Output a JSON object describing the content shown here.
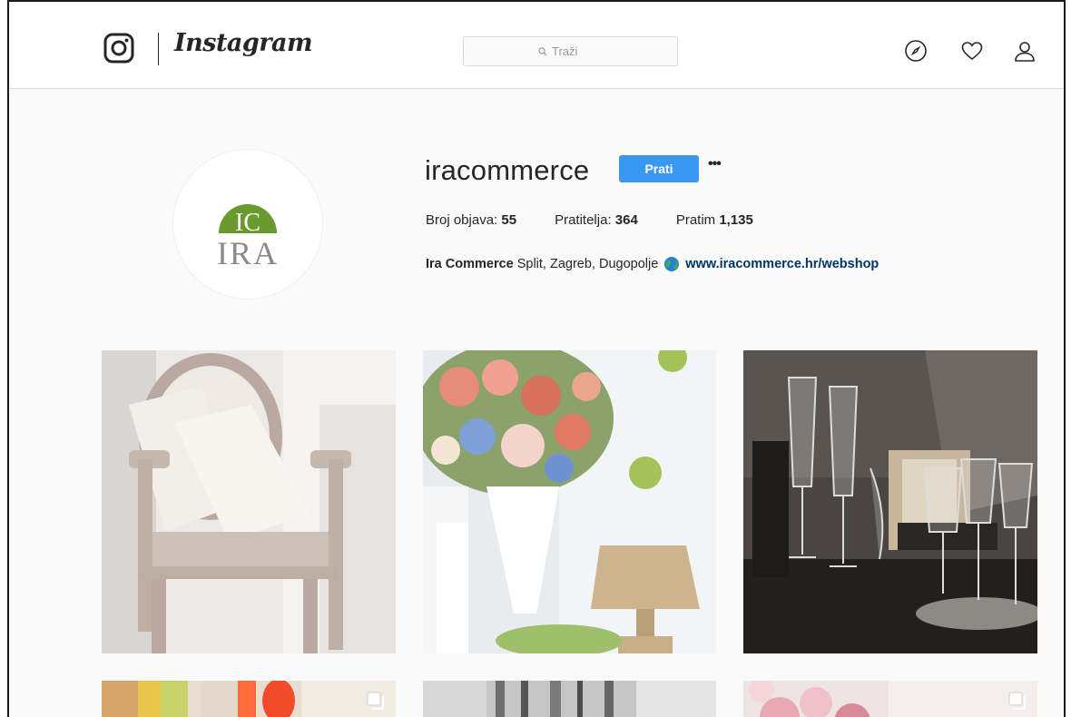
{
  "header": {
    "wordmark": "Instagram",
    "search": {
      "placeholder": "Traži",
      "icon": "search-icon"
    },
    "nav_icons": [
      "compass-icon",
      "heart-icon",
      "person-icon"
    ]
  },
  "profile": {
    "username": "iracommerce",
    "follow_label": "Prati",
    "more_label": "•••",
    "avatar_text": {
      "top": "IC",
      "bottom": "IRA"
    },
    "stats": {
      "posts_label": "Broj objava:",
      "posts": "55",
      "followers_label": "Pratitelja:",
      "followers": "364",
      "following_label": "Pratim",
      "following": "1,135"
    },
    "bio": {
      "name": "Ira Commerce",
      "text": "Split, Zagreb, Dugopolje",
      "link": "www.iracommerce.hr/webshop"
    }
  },
  "colors": {
    "accent": "#3897f0",
    "link": "#003569",
    "logo_green": "#6a9a2e",
    "logo_gray": "#8a8a8a"
  }
}
